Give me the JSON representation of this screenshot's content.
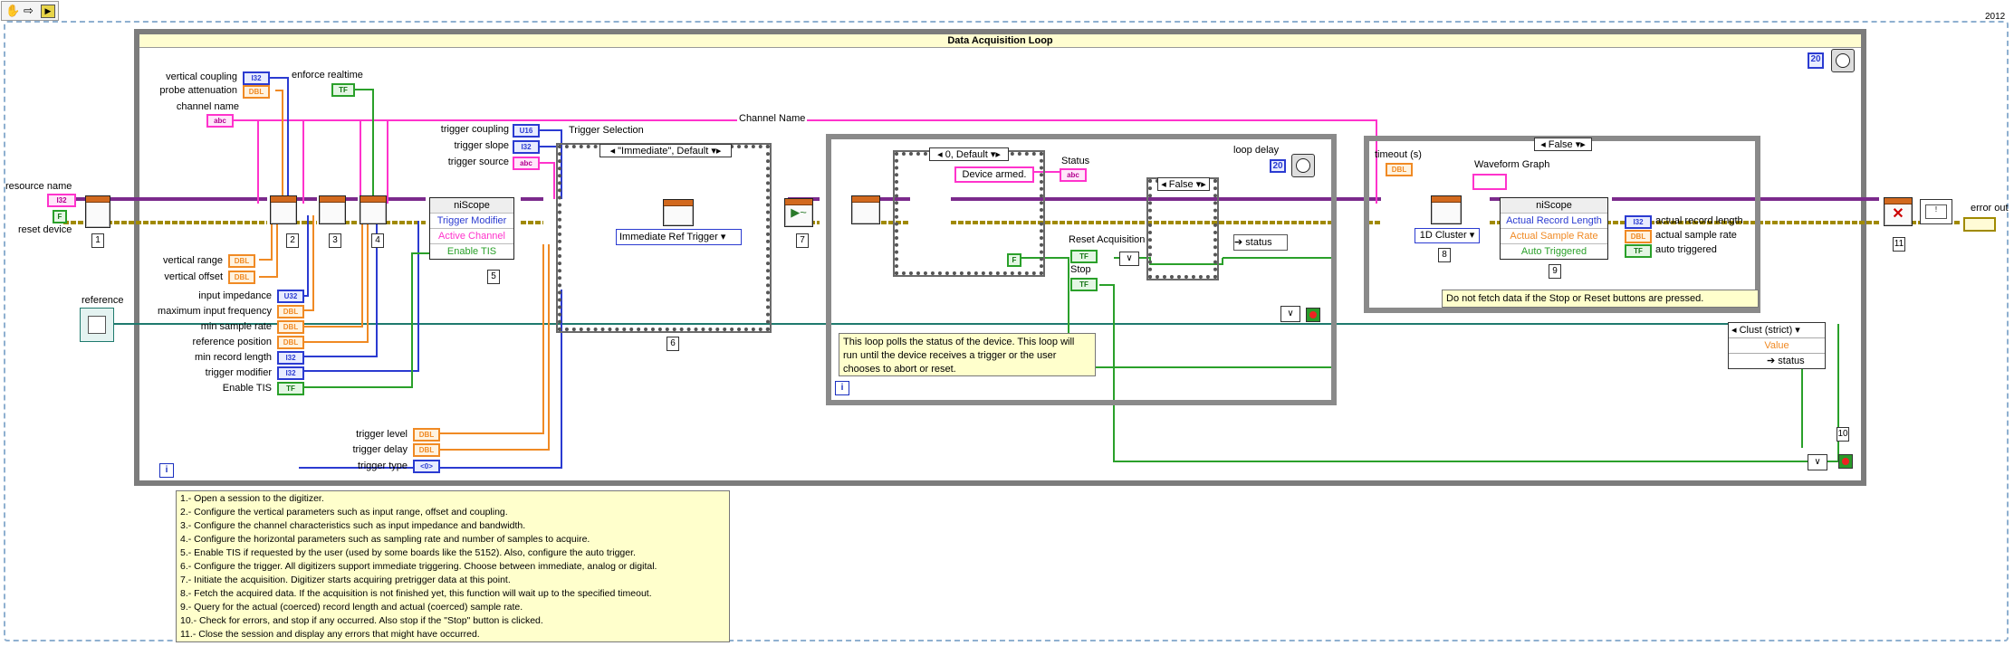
{
  "toolbar": {
    "icons": [
      "hand-icon",
      "arrow-icon",
      "run-icon"
    ]
  },
  "version_badge": "2012",
  "loop": {
    "title": "Data Acquisition Loop",
    "iteration_terminal": "i",
    "ms_constant": "20"
  },
  "inputs_left": {
    "resource_name": "resource name",
    "reset_device": "reset device",
    "reference": "reference",
    "vertical_coupling": "vertical coupling",
    "probe_attenuation": "probe attenuation",
    "channel_name": "channel name",
    "enforce_realtime": "enforce realtime",
    "vertical_range": "vertical range",
    "vertical_offset": "vertical offset",
    "input_impedance": "input impedance",
    "max_input_frequency": "maximum input frequency",
    "min_sample_rate": "min sample rate",
    "reference_position": "reference position",
    "min_record_length": "min record length",
    "trigger_modifier": "trigger modifier",
    "enable_tis": "Enable TIS",
    "trigger_coupling": "trigger coupling",
    "trigger_slope": "trigger slope",
    "trigger_source": "trigger source",
    "trigger_level": "trigger level",
    "trigger_delay": "trigger delay",
    "trigger_type": "trigger type"
  },
  "type_tags": {
    "i32": "I32",
    "u16": "U16",
    "u32": "U32",
    "dbl": "DBL",
    "tf": "TF",
    "abc": "abc",
    "enum": "<0>",
    "bool_f": "F",
    "cluster": "1D Cluster"
  },
  "channel_wire_label": "Channel Name",
  "niscope_property_node_1": {
    "title": "niScope",
    "rows": [
      "Trigger Modifier",
      "Active Channel",
      "Enable TIS"
    ]
  },
  "trigger_selection": {
    "label": "Trigger Selection",
    "case_selector": "\"Immediate\", Default",
    "ring_value": "Immediate Ref Trigger"
  },
  "status_loop": {
    "case_selector": "0, Default",
    "device_armed": "Device armed.",
    "status_label": "Status",
    "loop_delay_label": "loop delay",
    "loop_delay_value": "20",
    "false_case": "False",
    "status_unbundle": "status",
    "reset_acquisition": "Reset Acquisition",
    "stop": "Stop",
    "comment": "This loop polls the status of the device. This loop will run until the device receives a trigger or the user chooses to abort or reset.",
    "iteration_terminal": "i"
  },
  "fetch_case": {
    "case_selector": "False",
    "timeout_label": "timeout (s)",
    "waveform_graph": "Waveform Graph",
    "cluster_ring": "1D Cluster",
    "comment": "Do not fetch data if the Stop or Reset buttons are pressed.",
    "niscope_title": "niScope",
    "rows": [
      "Actual Record Length",
      "Actual Sample Rate",
      "Auto Triggered"
    ],
    "outputs": [
      "actual record length",
      "actual sample rate",
      "auto triggered"
    ]
  },
  "unbundle": {
    "title": "Clust (strict)",
    "value": "Value",
    "status": "status"
  },
  "error_out": "error out",
  "step_numbers": [
    "1",
    "2",
    "3",
    "4",
    "5",
    "6",
    "7",
    "8",
    "9",
    "10",
    "11"
  ],
  "notes": [
    "1.- Open a session to the digitizer.",
    "2.- Configure the vertical parameters such as input range, offset and coupling.",
    "3.- Configure the channel characteristics such as input impedance and bandwidth.",
    "4.- Configure the horizontal parameters such as sampling rate and number of samples to acquire.",
    "5.- Enable TIS if requested by the user (used by some boards like the 5152).  Also, configure the auto trigger.",
    "6.- Configure the trigger. All digitizers support immediate triggering. Choose between immediate, analog or digital.",
    "7.- Initiate the acquisition. Digitizer starts acquiring pretrigger data at this point.",
    "8.- Fetch the acquired data. If the acquisition is not finished yet, this function will wait up to the specified timeout.",
    "9.- Query for the actual (coerced) record length and actual (coerced) sample rate.",
    "10.- Check for errors, and stop if any occurred. Also stop if the \"Stop\" button is clicked.",
    "11.- Close the session and display any errors that might have occurred."
  ],
  "colors": {
    "dbl_orange": "#f08a24",
    "int_blue": "#2b3bd1",
    "bool_green": "#2aa02a",
    "string_pink": "#ff33cc",
    "error_yellow": "#c9b800",
    "refnum_teal": "#1f7a6e",
    "loop_gray": "#7c7c7c"
  }
}
